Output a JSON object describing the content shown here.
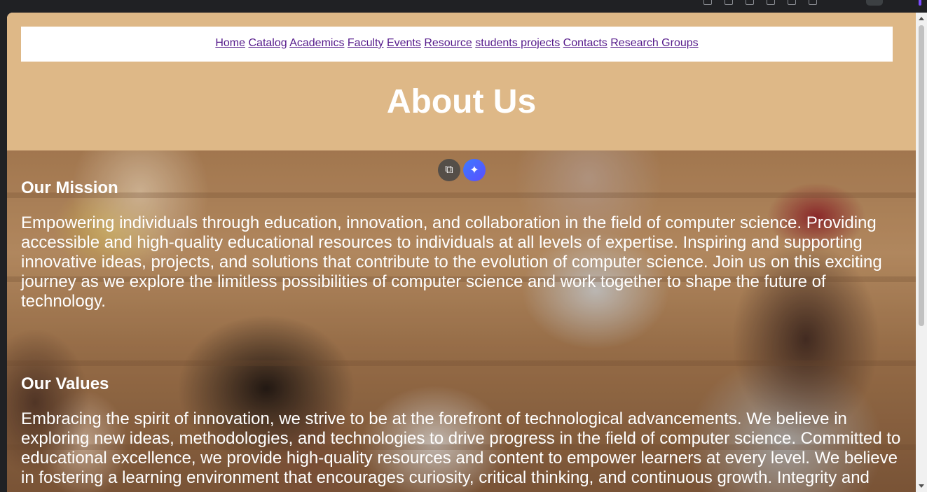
{
  "nav": {
    "links": [
      "Home",
      "Catalog",
      "Academics",
      "Faculty",
      "Events",
      "Resource",
      "students projects",
      "Contacts",
      "Research Groups"
    ]
  },
  "hero": {
    "title": "About Us"
  },
  "sections": {
    "mission": {
      "heading": "Our Mission",
      "text": "Empowering individuals through education, innovation, and collaboration in the field of computer science. Providing accessible and high-quality educational resources to individuals at all levels of expertise. Inspiring and supporting innovative ideas, projects, and solutions that contribute to the evolution of computer science. Join us on this exciting journey as we explore the limitless possibilities of computer science and work together to shape the future of technology."
    },
    "values": {
      "heading": "Our Values",
      "text": "Embracing the spirit of innovation, we strive to be at the forefront of technological advancements. We believe in exploring new ideas, methodologies, and technologies to drive progress in the field of computer science. Committed to educational excellence, we provide high-quality resources and content to empower learners at every level. We believe in fostering a learning environment that encourages curiosity, critical thinking, and continuous growth. Integrity and"
    }
  },
  "image_tools": {
    "lens_icon": "⧉",
    "ai_icon": "✦"
  },
  "colors": {
    "hero_bg": "#deb887",
    "link": "#551a8b",
    "heading_text": "#ffffff"
  }
}
